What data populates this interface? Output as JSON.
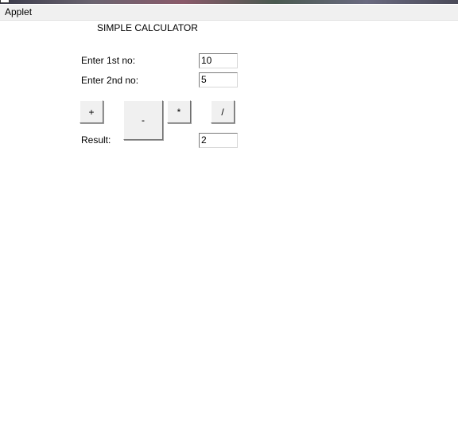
{
  "menubar": {
    "applet_label": "Applet"
  },
  "calculator": {
    "title": "SIMPLE CALCULATOR",
    "first_label": "Enter 1st no:",
    "first_value": "10",
    "second_label": "Enter 2nd no:",
    "second_value": "5",
    "result_label": "Result:",
    "result_value": "2",
    "buttons": {
      "add": "+",
      "subtract": "-",
      "multiply": "*",
      "divide": "/"
    }
  }
}
